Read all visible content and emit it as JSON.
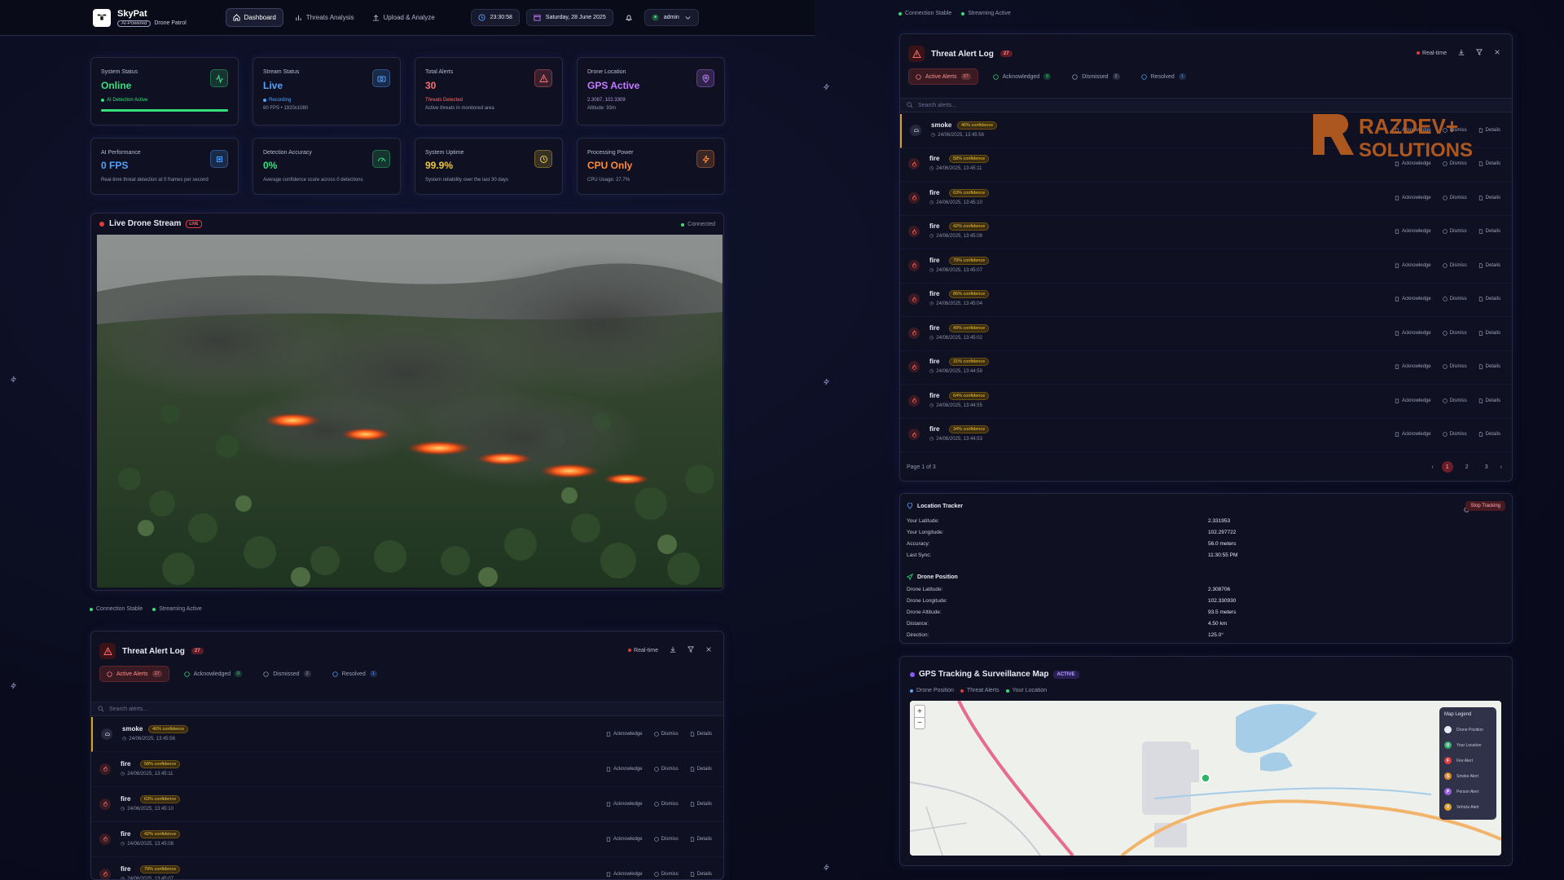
{
  "brand": {
    "name": "SkyPat",
    "badge": "AI-Powered",
    "subtitle": "Drone Patrol"
  },
  "nav": [
    {
      "label": "Dashboard",
      "icon": "home-icon",
      "active": true
    },
    {
      "label": "Threats Analysis",
      "icon": "chart-icon",
      "active": false
    },
    {
      "label": "Upload & Analyze",
      "icon": "upload-icon",
      "active": false
    }
  ],
  "topbar": {
    "time": "23:30:58",
    "date": "Saturday, 28 June 2025",
    "user": "admin"
  },
  "stats": [
    {
      "label": "System Status",
      "value": "Online",
      "sub": "AI Detection Active",
      "color": "#35e07c",
      "icon": "activity-icon",
      "progress": 1.0
    },
    {
      "label": "Stream Status",
      "value": "Live",
      "sub": "Recording",
      "sub2": "60 FPS • 1920x1080",
      "color": "#4fa3ff",
      "icon": "camera-icon"
    },
    {
      "label": "Total Alerts",
      "value": "30",
      "sub": "Threats Detected",
      "sub2": "Active threats in monitored area",
      "color": "#ff6b6b",
      "icon": "alert-triangle-icon"
    },
    {
      "label": "Drone Location",
      "value": "GPS Active",
      "sub": "2.3087, 102.3309",
      "sub2": "Altitude: 93m",
      "color": "#c27bff",
      "icon": "map-pin-icon"
    },
    {
      "label": "AI Performance",
      "value": "0 FPS",
      "sub": "Real-time threat detection at 0 frames per second",
      "color": "#4fa3ff",
      "icon": "cpu-icon"
    },
    {
      "label": "Detection Accuracy",
      "value": "0%",
      "sub": "Average confidence score across 0 detections",
      "color": "#35e07c",
      "icon": "gauge-icon"
    },
    {
      "label": "System Uptime",
      "value": "99.9%",
      "sub": "System reliability over the last 30 days",
      "color": "#f0c63a",
      "icon": "clock-icon"
    },
    {
      "label": "Processing Power",
      "value": "CPU Only",
      "sub": "CPU Usage: 27.7%",
      "color": "#ff8a3a",
      "icon": "bolt-icon"
    }
  ],
  "stream": {
    "title": "Live Drone Stream",
    "badge": "LIVE",
    "status": "Connected"
  },
  "status_bar": {
    "connection": "Connection Stable",
    "streaming": "Streaming Active"
  },
  "alert_log": {
    "title": "Threat Alert Log",
    "count": "27",
    "realtime": "Real-time",
    "tabs": [
      {
        "label": "Active Alerts",
        "count": "27"
      },
      {
        "label": "Acknowledged",
        "count": "0"
      },
      {
        "label": "Dismissed",
        "count": "2"
      },
      {
        "label": "Resolved",
        "count": "1"
      }
    ],
    "search_placeholder": "Search alerts...",
    "actions": {
      "ack": "Acknowledge",
      "dismiss": "Dismiss",
      "details": "Details"
    },
    "rows": [
      {
        "type": "smoke",
        "conf": "46% confidence",
        "time": "24/06/2025, 13:45:56"
      },
      {
        "type": "fire",
        "conf": "58% confidence",
        "time": "24/06/2025, 13:45:11"
      },
      {
        "type": "fire",
        "conf": "63% confidence",
        "time": "24/06/2025, 13:45:10"
      },
      {
        "type": "fire",
        "conf": "42% confidence",
        "time": "24/06/2025, 13:45:08"
      },
      {
        "type": "fire",
        "conf": "79% confidence",
        "time": "24/06/2025, 13:45:07"
      },
      {
        "type": "fire",
        "conf": "86% confidence",
        "time": "24/06/2025, 13:45:04"
      },
      {
        "type": "fire",
        "conf": "49% confidence",
        "time": "24/06/2025, 13:45:02"
      },
      {
        "type": "fire",
        "conf": "31% confidence",
        "time": "24/06/2025, 13:44:59"
      },
      {
        "type": "fire",
        "conf": "64% confidence",
        "time": "24/06/2025, 13:44:55"
      },
      {
        "type": "fire",
        "conf": "34% confidence",
        "time": "24/06/2025, 13:44:53"
      }
    ],
    "page_label": "Page 1 of 3",
    "pages": [
      "1",
      "2",
      "3"
    ]
  },
  "location": {
    "title": "Location Tracker",
    "stop": "Stop Tracking",
    "user_fields": [
      {
        "k": "Your Latitude:",
        "v": "2.331953"
      },
      {
        "k": "Your Longitude:",
        "v": "102.297722"
      },
      {
        "k": "Accuracy:",
        "v": "56.0 meters"
      },
      {
        "k": "Last Sync:",
        "v": "11:30:55 PM"
      }
    ],
    "drone_title": "Drone Position",
    "drone_fields": [
      {
        "k": "Drone Latitude:",
        "v": "2.308706"
      },
      {
        "k": "Drone Longitude:",
        "v": "102.330930"
      },
      {
        "k": "Drone Altitude:",
        "v": "93.5 meters"
      },
      {
        "k": "Distance:",
        "v": "4.50 km"
      },
      {
        "k": "Direction:",
        "v": "125.0°"
      }
    ]
  },
  "gps_map": {
    "title": "GPS Tracking & Surveillance Map",
    "badge": "ACTIVE",
    "legend_top": [
      "Drone Position",
      "Threat Alerts",
      "Your Location"
    ],
    "legend_title": "Map Legend",
    "legend": [
      {
        "label": "Drone Position",
        "color": "#e9eaf3",
        "glyph": ""
      },
      {
        "label": "Your Location",
        "color": "#2fb36b",
        "glyph": "U"
      },
      {
        "label": "Fire Alert",
        "color": "#e23b3b",
        "glyph": "F"
      },
      {
        "label": "Smoke Alert",
        "color": "#e08a2a",
        "glyph": "S"
      },
      {
        "label": "Person Alert",
        "color": "#9a5be0",
        "glyph": "P"
      },
      {
        "label": "Vehicle Alert",
        "color": "#e0a02a",
        "glyph": "V"
      }
    ],
    "zoom_in": "+",
    "zoom_out": "−"
  },
  "watermark": {
    "line1": "RAZDEV+",
    "line2": "SOLUTIONS"
  },
  "colors": {
    "fire": "#ff6b6b",
    "smoke": "#b7bbd0",
    "accent_red": "#e03a3a",
    "warning": "#d9a21b"
  }
}
